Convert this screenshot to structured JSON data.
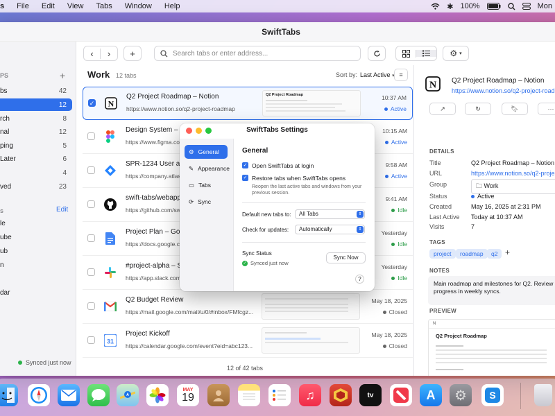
{
  "menubar": {
    "items": [
      "s",
      "File",
      "Edit",
      "View",
      "Tabs",
      "Window",
      "Help"
    ],
    "battery": "100%",
    "clock": "Mon"
  },
  "window": {
    "title": "SwiftTabs"
  },
  "sidebar": {
    "section_header": "PS",
    "groups": [
      {
        "label": "bs",
        "count": "42"
      },
      {
        "label": "",
        "count": "12"
      },
      {
        "label": "rch",
        "count": "8"
      },
      {
        "label": "nal",
        "count": "12"
      },
      {
        "label": "ping",
        "count": "5"
      },
      {
        "label": "Later",
        "count": "6"
      },
      {
        "label": "",
        "count": "4"
      },
      {
        "label": "ved",
        "count": "23"
      }
    ],
    "section2_header": "s",
    "edit_label": "Edit",
    "sites": [
      "le",
      "ube",
      "ub",
      "n",
      "",
      "dar"
    ],
    "sync_status": "Synced just now"
  },
  "toolbar": {
    "search_placeholder": "Search tabs or enter address..."
  },
  "list": {
    "title": "Work",
    "count": "12 tabs",
    "sort_label": "Sort by:",
    "sort_value": "Last Active",
    "footer": "12 of 42 tabs",
    "rows": [
      {
        "title": "Q2 Project Roadmap – Notion",
        "url": "https://www.notion.so/q2-project-roadmap",
        "time": "10:37 AM",
        "status": "Active",
        "icon": "notion-icon",
        "checked": true
      },
      {
        "title": "Design System –",
        "url": "https://www.figma.co",
        "time": "10:15 AM",
        "status": "Active",
        "icon": "figma-icon",
        "checked": false
      },
      {
        "title": "SPR-1234  User a",
        "url": "https://company.atlas",
        "time": "9:58 AM",
        "status": "Active",
        "icon": "jira-icon",
        "checked": false
      },
      {
        "title": "swift-tabs/webapp",
        "url": "https://github.com/sw",
        "time": "9:41 AM",
        "status": "Idle",
        "icon": "github-icon",
        "checked": false
      },
      {
        "title": "Project Plan – Goo",
        "url": "https://docs.google.co",
        "time": "Yesterday",
        "status": "Idle",
        "icon": "docs-icon",
        "checked": false
      },
      {
        "title": "#project-alpha – S",
        "url": "https://app.slack.com",
        "time": "Yesterday",
        "status": "Idle",
        "icon": "slack-icon",
        "checked": false
      },
      {
        "title": "Q2 Budget Review",
        "url": "https://mail.google.com/mail/u/0/#inbox/FMfcgz...",
        "time": "May 18, 2025",
        "status": "Closed",
        "icon": "gmail-icon",
        "checked": false
      },
      {
        "title": "Project Kickoff",
        "url": "https://calendar.google.com/event?eid=abc123...",
        "time": "May 18, 2025",
        "status": "Closed",
        "icon": "calendar-icon",
        "checked": false
      }
    ],
    "thumb_title": "Q2 Project Roadmap"
  },
  "detail": {
    "title": "Q2 Project Roadmap – Notion",
    "url": "https://www.notion.so/q2-project-roadma",
    "details_header": "DETAILS",
    "fields": [
      {
        "k": "Title",
        "v": "Q2 Project Roadmap – Notion"
      },
      {
        "k": "URL",
        "v": "https://www.notion.so/q2-project"
      },
      {
        "k": "Group",
        "v": "Work"
      },
      {
        "k": "Status",
        "v": "Active"
      },
      {
        "k": "Created",
        "v": "May 16, 2025 at 2:31 PM"
      },
      {
        "k": "Last Active",
        "v": "Today at 10:37 AM"
      },
      {
        "k": "Visits",
        "v": "7"
      }
    ],
    "tags_header": "TAGS",
    "tags": [
      "project",
      "roadmap",
      "q2"
    ],
    "notes_header": "NOTES",
    "notes": "Main roadmap and milestones for Q2. Review progress in weekly syncs.",
    "preview_header": "PREVIEW",
    "preview_title": "Q2 Project Roadmap"
  },
  "settings": {
    "title": "SwiftTabs Settings",
    "nav": [
      "General",
      "Appearance",
      "Tabs",
      "Sync"
    ],
    "heading": "General",
    "open_at_login": "Open SwiftTabs at login",
    "restore_tabs": "Restore tabs when SwiftTabs opens",
    "restore_hint": "Reopen the last active tabs and windows from your previous session.",
    "default_new_tabs_label": "Default new tabs to:",
    "default_new_tabs_value": "All Tabs",
    "check_updates_label": "Check for updates:",
    "check_updates_value": "Automatically",
    "sync_status_label": "Sync Status",
    "sync_status_value": "Synced just now",
    "sync_button": "Sync Now",
    "help": "?"
  },
  "dock": {
    "calendar_month": "MAY",
    "calendar_day": "19"
  },
  "colors": {
    "accent": "#2f6fea",
    "active": "#2f6fea",
    "idle": "#2e9e4a",
    "closed": "#666666"
  }
}
